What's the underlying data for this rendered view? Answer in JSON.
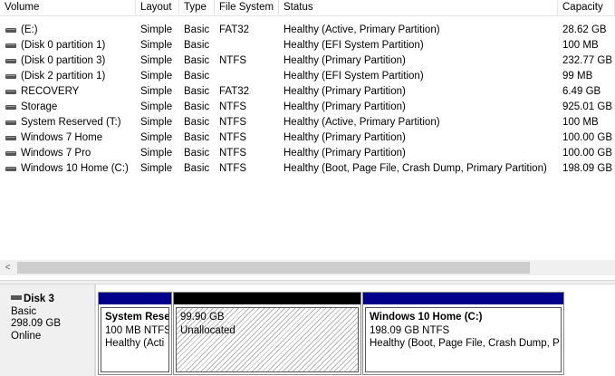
{
  "columns": {
    "volume": "Volume",
    "layout": "Layout",
    "type": "Type",
    "filesystem": "File System",
    "status": "Status",
    "capacity": "Capacity"
  },
  "volumes": [
    {
      "name": "(E:)",
      "layout": "Simple",
      "type": "Basic",
      "fs": "FAT32",
      "status": "Healthy (Active, Primary Partition)",
      "capacity": "28.62 GB"
    },
    {
      "name": "(Disk 0 partition 1)",
      "layout": "Simple",
      "type": "Basic",
      "fs": "",
      "status": "Healthy (EFI System Partition)",
      "capacity": "100 MB"
    },
    {
      "name": "(Disk 0 partition 3)",
      "layout": "Simple",
      "type": "Basic",
      "fs": "NTFS",
      "status": "Healthy (Primary Partition)",
      "capacity": "232.77 GB"
    },
    {
      "name": "(Disk 2 partition 1)",
      "layout": "Simple",
      "type": "Basic",
      "fs": "",
      "status": "Healthy (EFI System Partition)",
      "capacity": "99 MB"
    },
    {
      "name": "RECOVERY",
      "layout": "Simple",
      "type": "Basic",
      "fs": "FAT32",
      "status": "Healthy (Primary Partition)",
      "capacity": "6.49 GB"
    },
    {
      "name": "Storage",
      "layout": "Simple",
      "type": "Basic",
      "fs": "NTFS",
      "status": "Healthy (Primary Partition)",
      "capacity": "925.01 GB"
    },
    {
      "name": "System Reserved (T:)",
      "layout": "Simple",
      "type": "Basic",
      "fs": "NTFS",
      "status": "Healthy (Active, Primary Partition)",
      "capacity": "100 MB"
    },
    {
      "name": "Windows 7 Home",
      "layout": "Simple",
      "type": "Basic",
      "fs": "NTFS",
      "status": "Healthy (Primary Partition)",
      "capacity": "100.00 GB"
    },
    {
      "name": "Windows 7 Pro",
      "layout": "Simple",
      "type": "Basic",
      "fs": "NTFS",
      "status": "Healthy (Primary Partition)",
      "capacity": "100.00 GB"
    },
    {
      "name": "Windows 10 Home (C:)",
      "layout": "Simple",
      "type": "Basic",
      "fs": "NTFS",
      "status": "Healthy (Boot, Page File, Crash Dump, Primary Partition)",
      "capacity": "198.09 GB"
    }
  ],
  "scroll_left_glyph": "<",
  "disk": {
    "name": "Disk 3",
    "type": "Basic",
    "size": "298.09 GB",
    "state": "Online"
  },
  "partitions": [
    {
      "title": "System Rese",
      "line1": "100 MB NTFS",
      "line2": "Healthy (Acti"
    },
    {
      "title": "",
      "line1": "99.90 GB",
      "line2": "Unallocated"
    },
    {
      "title": "Windows 10 Home  (C:)",
      "line1": "198.09 GB NTFS",
      "line2": "Healthy (Boot, Page File, Crash Dump, P"
    }
  ],
  "icons": {
    "volume": "drive-icon",
    "disk": "disk-icon"
  },
  "colors": {
    "primary_partition": "#00008b",
    "unallocated": "#000000"
  }
}
